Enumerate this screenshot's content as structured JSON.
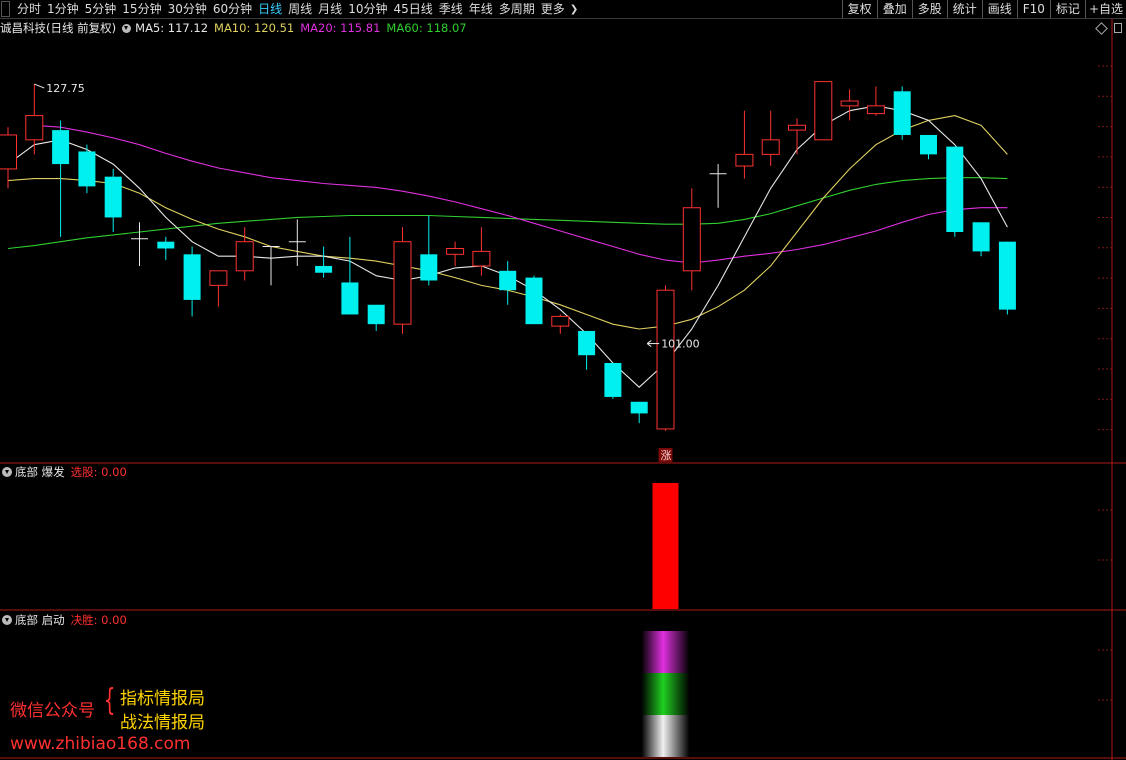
{
  "toolbar": {
    "periods": [
      "分时",
      "1分钟",
      "5分钟",
      "15分钟",
      "30分钟",
      "60分钟",
      "日线",
      "周线",
      "月线",
      "10分钟",
      "45日线",
      "季线",
      "年线",
      "多周期",
      "更多"
    ],
    "active_period": "日线",
    "right_buttons": [
      "复权",
      "叠加",
      "多股",
      "统计",
      "画线",
      "F10",
      "标记",
      "+自选"
    ]
  },
  "main": {
    "title": "诚昌科技(日线 前复权)",
    "ma": [
      {
        "label": "MA5: 117.12",
        "color": "#e8e8e8"
      },
      {
        "label": "MA10: 120.51",
        "color": "#e0d060"
      },
      {
        "label": "MA20: 115.81",
        "color": "#e030e0"
      },
      {
        "label": "MA60: 118.07",
        "color": "#30d030"
      }
    ],
    "high_label": "127.75",
    "low_label": "101.00",
    "zhang_label": "涨"
  },
  "chart_data": {
    "type": "candlestick",
    "title": "诚昌科技(日线 前复权)",
    "series_ohlc": [
      {
        "o": 119.0,
        "h": 123.3,
        "l": 117.0,
        "c": 122.5
      },
      {
        "o": 122.0,
        "h": 127.75,
        "l": 120.5,
        "c": 124.5
      },
      {
        "o": 123.0,
        "h": 124.0,
        "l": 112.0,
        "c": 119.5
      },
      {
        "o": 120.8,
        "h": 121.5,
        "l": 116.5,
        "c": 117.2
      },
      {
        "o": 118.2,
        "h": 119.0,
        "l": 112.5,
        "c": 114.0
      },
      {
        "o": 111.8,
        "h": 113.5,
        "l": 109.0,
        "c": 111.5
      },
      {
        "o": 111.5,
        "h": 112.0,
        "l": 109.6,
        "c": 110.8
      },
      {
        "o": 110.2,
        "h": 111.0,
        "l": 103.8,
        "c": 105.5
      },
      {
        "o": 107.0,
        "h": 108.0,
        "l": 104.8,
        "c": 108.5
      },
      {
        "o": 108.5,
        "h": 113.0,
        "l": 107.5,
        "c": 111.5
      },
      {
        "o": 111.0,
        "h": 111.0,
        "l": 107.0,
        "c": 111.0
      },
      {
        "o": 111.5,
        "h": 113.8,
        "l": 109.0,
        "c": 111.5
      },
      {
        "o": 109.0,
        "h": 111.0,
        "l": 107.8,
        "c": 108.3
      },
      {
        "o": 107.3,
        "h": 112.0,
        "l": 105.0,
        "c": 104.0
      },
      {
        "o": 105.0,
        "h": 105.0,
        "l": 102.3,
        "c": 103.0
      },
      {
        "o": 103.0,
        "h": 113.0,
        "l": 102.0,
        "c": 111.5
      },
      {
        "o": 110.2,
        "h": 114.2,
        "l": 107.0,
        "c": 107.5
      },
      {
        "o": 110.2,
        "h": 111.5,
        "l": 109.0,
        "c": 110.8
      },
      {
        "o": 109.0,
        "h": 113.0,
        "l": 108.0,
        "c": 110.5
      },
      {
        "o": 108.5,
        "h": 109.5,
        "l": 105.0,
        "c": 106.5
      },
      {
        "o": 107.8,
        "h": 108.0,
        "l": 103.0,
        "c": 103.0
      },
      {
        "o": 102.8,
        "h": 104.0,
        "l": 102.0,
        "c": 103.8
      },
      {
        "o": 102.3,
        "h": 102.3,
        "l": 98.3,
        "c": 99.8
      },
      {
        "o": 99.0,
        "h": 99.0,
        "l": 95.3,
        "c": 95.5
      },
      {
        "o": 95.0,
        "h": 95.0,
        "l": 92.8,
        "c": 93.8
      },
      {
        "o": 92.2,
        "h": 107.0,
        "l": 92.0,
        "c": 106.5
      },
      {
        "o": 108.5,
        "h": 117.0,
        "l": 106.5,
        "c": 115.0
      },
      {
        "o": 118.5,
        "h": 119.5,
        "l": 115.0,
        "c": 118.3
      },
      {
        "o": 119.3,
        "h": 125.0,
        "l": 118.0,
        "c": 120.5
      },
      {
        "o": 120.5,
        "h": 125.0,
        "l": 119.3,
        "c": 122.0
      },
      {
        "o": 123.0,
        "h": 124.2,
        "l": 120.5,
        "c": 123.5
      },
      {
        "o": 122.0,
        "h": 127.5,
        "l": 122.0,
        "c": 128.0
      },
      {
        "o": 125.5,
        "h": 127.2,
        "l": 124.0,
        "c": 126.0
      },
      {
        "o": 124.7,
        "h": 127.5,
        "l": 124.5,
        "c": 125.5
      },
      {
        "o": 127.0,
        "h": 127.5,
        "l": 122.0,
        "c": 122.5
      },
      {
        "o": 122.5,
        "h": 122.5,
        "l": 120.0,
        "c": 120.5
      },
      {
        "o": 121.3,
        "h": 121.3,
        "l": 112.0,
        "c": 112.5
      },
      {
        "o": 113.5,
        "h": 113.5,
        "l": 110.0,
        "c": 110.5
      },
      {
        "o": 111.5,
        "h": 111.5,
        "l": 104.0,
        "c": 104.5
      }
    ],
    "ma5": [
      119.5,
      121.5,
      122.0,
      121.0,
      119.5,
      117.0,
      114.0,
      111.5,
      110.0,
      110.0,
      109.8,
      110.0,
      110.0,
      109.5,
      108.0,
      107.5,
      108.0,
      108.8,
      109.0,
      108.0,
      106.5,
      104.5,
      102.0,
      99.0,
      96.5,
      99.0,
      102.5,
      107.0,
      112.0,
      117.0,
      121.0,
      123.5,
      125.0,
      125.5,
      125.0,
      124.0,
      121.5,
      118.0,
      113.0
    ],
    "ma10": [
      117.8,
      118.0,
      118.0,
      117.8,
      117.5,
      116.5,
      115.0,
      113.8,
      112.8,
      112.0,
      111.0,
      110.5,
      110.0,
      109.8,
      109.5,
      109.0,
      108.5,
      107.8,
      107.0,
      106.5,
      105.8,
      105.0,
      104.0,
      103.0,
      102.5,
      102.8,
      103.5,
      104.8,
      106.5,
      109.0,
      112.5,
      116.0,
      119.0,
      121.5,
      123.0,
      124.0,
      124.5,
      123.5,
      120.5
    ],
    "ma20": [
      null,
      123.5,
      123.3,
      122.8,
      122.2,
      121.5,
      120.6,
      119.8,
      119.1,
      118.6,
      118.1,
      117.8,
      117.5,
      117.3,
      117.1,
      116.7,
      116.2,
      115.6,
      114.9,
      114.2,
      113.4,
      112.6,
      111.8,
      111.0,
      110.2,
      109.6,
      109.3,
      109.6,
      110.0,
      110.3,
      110.7,
      111.2,
      111.9,
      112.6,
      113.5,
      114.3,
      114.8,
      115.0,
      115.0
    ],
    "ma60": [
      110.8,
      111.1,
      111.5,
      111.9,
      112.2,
      112.5,
      112.8,
      113.1,
      113.4,
      113.6,
      113.8,
      114.0,
      114.1,
      114.2,
      114.2,
      114.2,
      114.2,
      114.1,
      114.0,
      113.9,
      113.8,
      113.7,
      113.6,
      113.5,
      113.4,
      113.3,
      113.3,
      113.4,
      113.8,
      114.4,
      115.2,
      116.0,
      116.8,
      117.4,
      117.8,
      118.0,
      118.1,
      118.1,
      118.0
    ],
    "ylim": [
      90,
      132
    ],
    "high_marker": {
      "index": 1,
      "value": 127.75
    },
    "low_marker": {
      "index": 24,
      "value": 101.0
    }
  },
  "pane1": {
    "name": "底部 爆发",
    "value_label": "选股: 0.00",
    "bar_index": 25,
    "bar_color": "#ff0000"
  },
  "pane2": {
    "name": "底部 启动",
    "value_label": "决胜: 0.00",
    "bar_index": 25,
    "bar_colors": [
      "#e030e0",
      "#20d020",
      "#f0f0f0"
    ]
  },
  "watermark": {
    "wechat": "微信公众号",
    "name1": "指标情报局",
    "name2": "战法情报局",
    "url": "www.zhibiao168.com"
  }
}
